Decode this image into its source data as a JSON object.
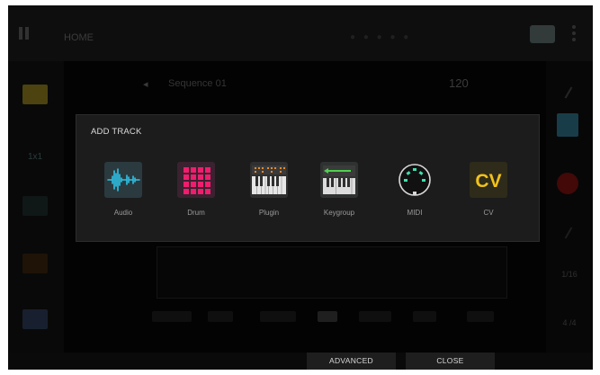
{
  "background": {
    "top_title": "HOME",
    "sequence_name": "Sequence 01",
    "bpm": "120",
    "right_rail_text_a": "1/16",
    "right_rail_text_b": "4 /4"
  },
  "dialog": {
    "title": "ADD TRACK",
    "options": [
      {
        "label": "Audio",
        "icon": "waveform-icon"
      },
      {
        "label": "Drum",
        "icon": "drum-pads-icon"
      },
      {
        "label": "Plugin",
        "icon": "keyboard-synth-icon"
      },
      {
        "label": "Keygroup",
        "icon": "keygroup-keyboard-icon"
      },
      {
        "label": "MIDI",
        "icon": "midi-din-icon"
      },
      {
        "label": "CV",
        "icon": "cv-icon"
      }
    ],
    "cv_glyph": "CV"
  },
  "footer": {
    "advanced_label": "ADVANCED",
    "close_label": "CLOSE"
  },
  "colors": {
    "audio": "#2ec4e8",
    "drum": "#f01d6e",
    "plugin_accent": "#e88a2a",
    "keygroup_accent": "#4fd04f",
    "midi": "#3fe0b0",
    "cv": "#f2c21a"
  }
}
